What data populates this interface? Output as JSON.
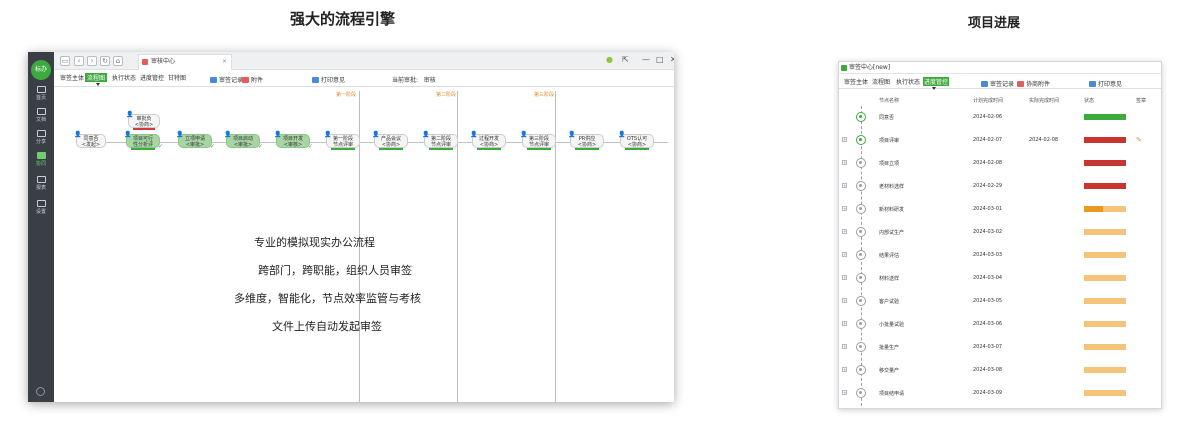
{
  "headings": {
    "left": "强大的流程引擎",
    "right": "项目进展"
  },
  "left_window": {
    "rail": {
      "logo": "标办",
      "items": [
        "首页",
        "文档",
        "分享",
        "协同",
        "报表",
        "设置"
      ],
      "active_index": 3
    },
    "title_tab": "审核中心",
    "tabs": [
      "审签主体",
      "流程图",
      "执行状态",
      "进度管控",
      "甘特图"
    ],
    "active_tab": 1,
    "actions": {
      "record": "审签记录",
      "attachment": "附件",
      "print": "打印意见"
    },
    "current_reviewer_label": "当前审批:",
    "current_reviewer_value": "审核",
    "stages": [
      "第一阶段",
      "第二阶段",
      "第三阶段"
    ],
    "nodes": [
      {
        "label": "同意否\n<发起>",
        "state": "normal"
      },
      {
        "label": "审批负\n<协商>",
        "state": "normal",
        "bar": "red"
      },
      {
        "label": "项目可行\n性分析评",
        "state": "done",
        "bar": "green"
      },
      {
        "label": "立项申请\n<审批>",
        "state": "done"
      },
      {
        "label": "项目启动\n<审批>",
        "state": "done"
      },
      {
        "label": "项目开发\n<审核>",
        "state": "done"
      },
      {
        "label": "第一阶段\n节点评审",
        "state": "normal",
        "bar": "green"
      },
      {
        "label": "产品会议\n<协商>",
        "state": "normal",
        "bar": "green"
      },
      {
        "label": "第二阶段\n节点评审",
        "state": "normal",
        "bar": "green"
      },
      {
        "label": "过程开发\n<协商>",
        "state": "normal",
        "bar": "green"
      },
      {
        "label": "第三阶段\n节点评审",
        "state": "normal",
        "bar": "green"
      },
      {
        "label": "PR供应\n<协商>",
        "state": "normal",
        "bar": "green"
      },
      {
        "label": "OTS认可\n<协商>",
        "state": "normal",
        "bar": "green"
      }
    ],
    "promo_lines": [
      "专业的模拟现实办公流程",
      "跨部门，跨职能，组织人员审签",
      "多维度，智能化，节点效率监管与考核",
      "文件上传自动发起审签"
    ]
  },
  "right_window": {
    "title": "审签中心[new]",
    "tabs": [
      "审签主体",
      "流程图",
      "执行状态",
      "进度管控"
    ],
    "active_tab": 3,
    "actions": {
      "record": "审签记录",
      "attachment": "协商附件",
      "print": "打印意见"
    },
    "columns": [
      "节点名称",
      "计划完成时间",
      "实际完成时间",
      "状态",
      "签章"
    ],
    "rows": [
      {
        "name": "同意否",
        "plan": "2024-02-06",
        "actual": "",
        "progress": 1.0,
        "color": "#3eaa3e",
        "done": true,
        "sign": false
      },
      {
        "name": "项目评审",
        "plan": "2024-02-07",
        "actual": "2024-02-08",
        "progress": 1.0,
        "color": "#c8352f",
        "done": true,
        "sign": true
      },
      {
        "name": "项目立项",
        "plan": "2024-02-08",
        "actual": "",
        "progress": 1.0,
        "color": "#c8352f",
        "done": false,
        "sign": false
      },
      {
        "name": "老材料选样",
        "plan": "2024-02-29",
        "actual": "",
        "progress": 1.0,
        "color": "#c8352f",
        "done": false,
        "sign": false
      },
      {
        "name": "新材料研发",
        "plan": "2024-03-01",
        "actual": "",
        "progress": 0.45,
        "color": "#e89a20",
        "done": false,
        "sign": false
      },
      {
        "name": "内部试生产",
        "plan": "2024-03-02",
        "actual": "",
        "progress": 0,
        "color": "#e89a20",
        "done": false,
        "sign": false
      },
      {
        "name": "结果评估",
        "plan": "2024-03-03",
        "actual": "",
        "progress": 0,
        "color": "#e89a20",
        "done": false,
        "sign": false
      },
      {
        "name": "材料送样",
        "plan": "2024-03-04",
        "actual": "",
        "progress": 0,
        "color": "#e89a20",
        "done": false,
        "sign": false
      },
      {
        "name": "客户试验",
        "plan": "2024-03-05",
        "actual": "",
        "progress": 0,
        "color": "#e89a20",
        "done": false,
        "sign": false
      },
      {
        "name": "小批量试验",
        "plan": "2024-03-06",
        "actual": "",
        "progress": 0,
        "color": "#e89a20",
        "done": false,
        "sign": false
      },
      {
        "name": "批量生产",
        "plan": "2024-03-07",
        "actual": "",
        "progress": 0,
        "color": "#e89a20",
        "done": false,
        "sign": false
      },
      {
        "name": "移交量产",
        "plan": "2024-03-08",
        "actual": "",
        "progress": 0,
        "color": "#e89a20",
        "done": false,
        "sign": false
      },
      {
        "name": "项目结申请",
        "plan": "2024-03-09",
        "actual": "",
        "progress": 0,
        "color": "#e89a20",
        "done": false,
        "sign": false
      }
    ]
  }
}
